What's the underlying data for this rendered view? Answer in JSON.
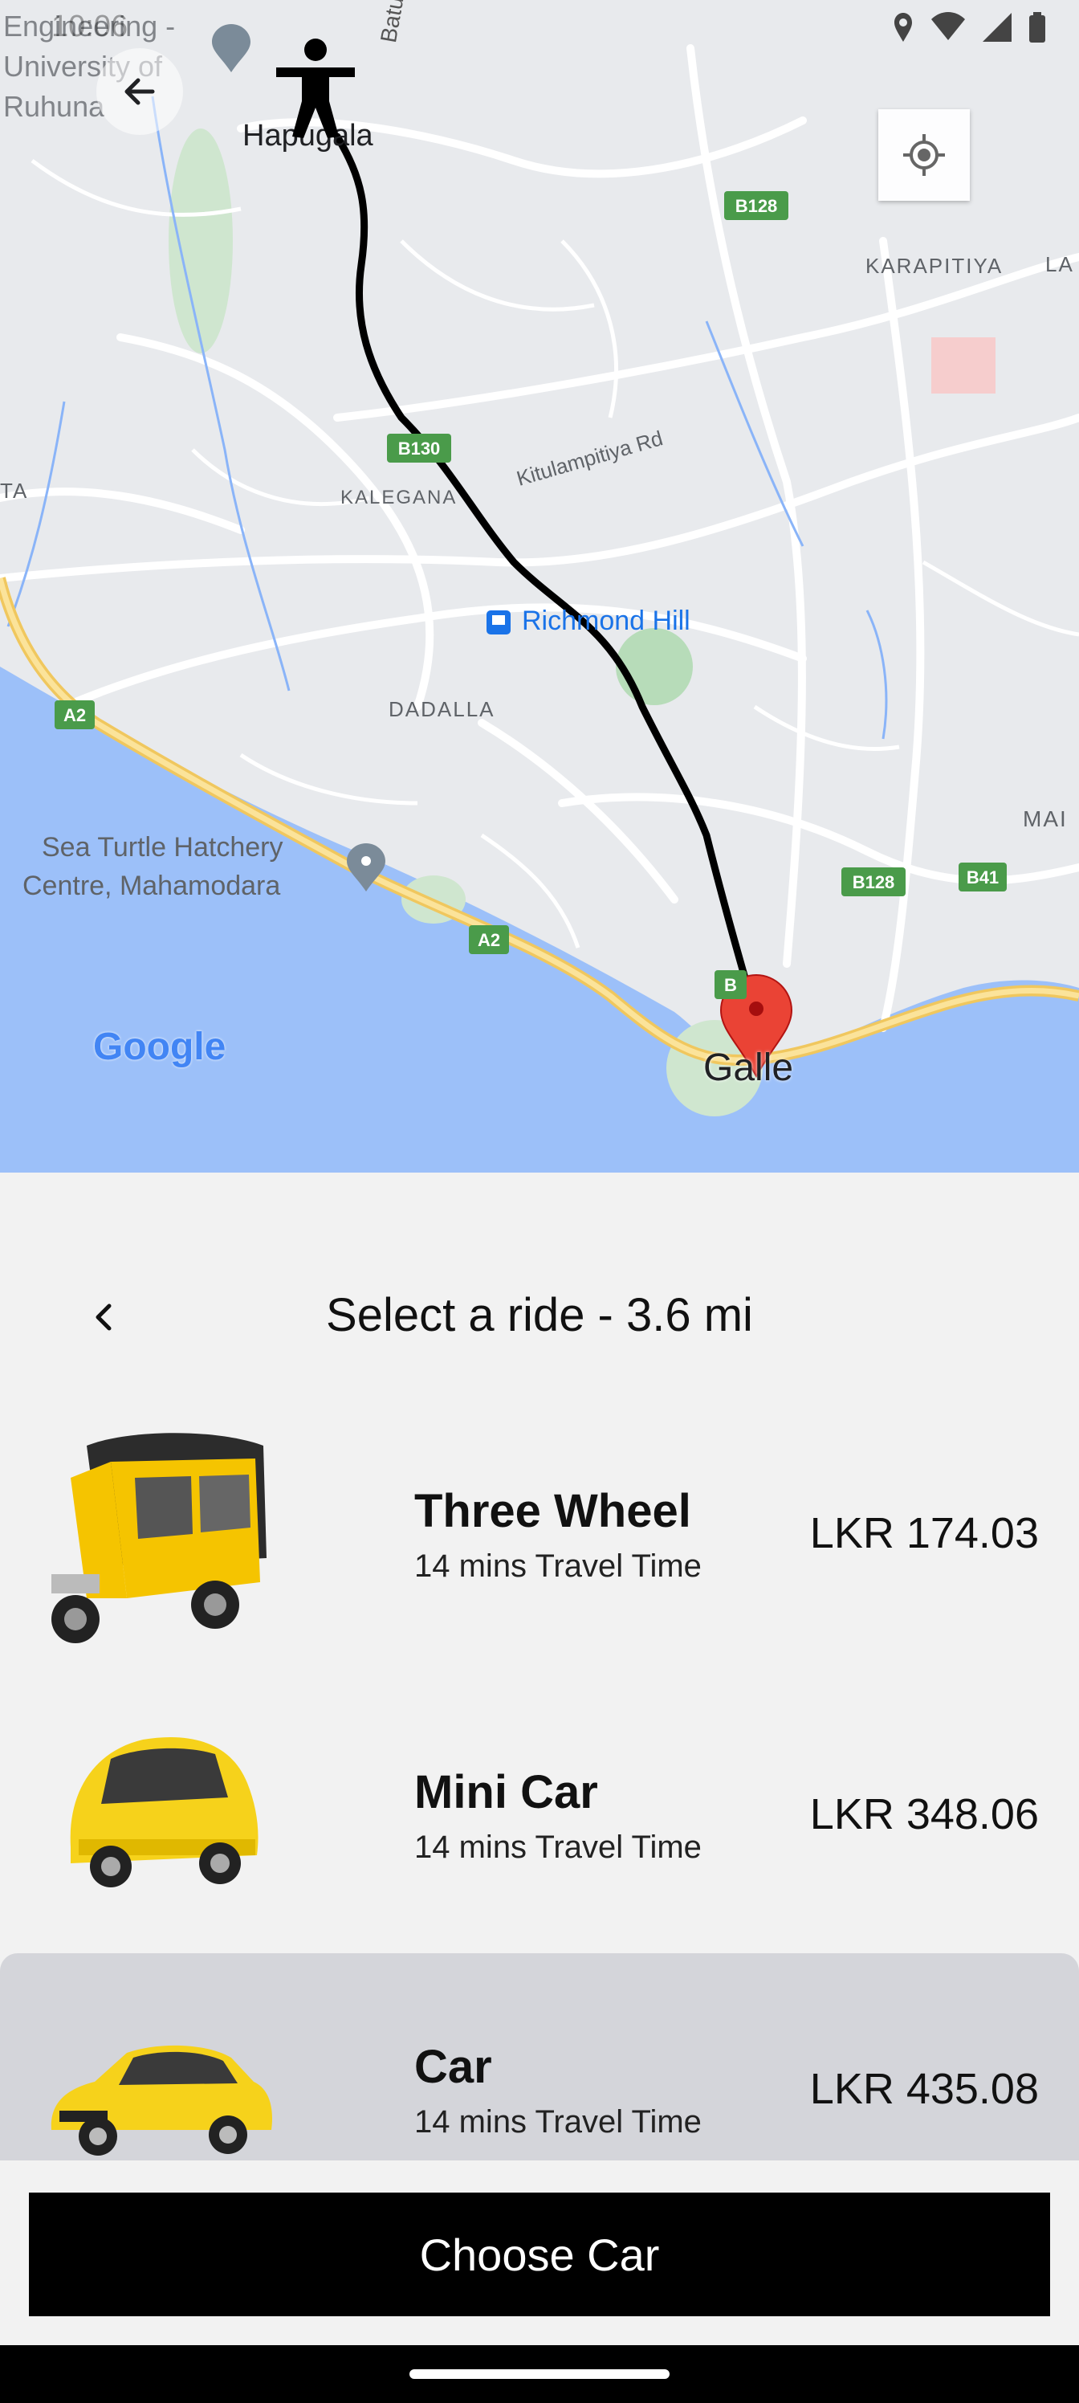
{
  "status": {
    "time": "10:06"
  },
  "map": {
    "labels": {
      "engineering": "Engineering - University of Ruhuna",
      "hapugala": "Hapugala",
      "batuwan": "Batuwan",
      "karapitiya": "KARAPITIYA",
      "la": "LA",
      "ta": "TA",
      "kulampitiya": "Kitulampitiya Rd",
      "kalegana": "KALEGANA",
      "richmond": "Richmond Hill",
      "dadalla": "DADALLA",
      "seaturtle1": "Sea Turtle Hatchery",
      "seaturtle2": "Centre, Mahamodara",
      "ma": "MAI",
      "galle": "Galle",
      "google": "Google"
    },
    "shields": {
      "b128a": "B128",
      "b130": "B130",
      "a2a": "A2",
      "a2b": "A2",
      "b128b": "B128",
      "b41": "B41",
      "b": "B"
    },
    "colors": {
      "land": "#e8eaed",
      "water": "#9cc0f9",
      "park": "#c8e6c9",
      "route": "#000000",
      "highway": "#f8d87a",
      "pin": "#e53935"
    }
  },
  "panel": {
    "title": "Select a ride - 3.6 mi",
    "rides": [
      {
        "name": "Three Wheel",
        "time": "14 mins Travel Time",
        "price": "LKR 174.03",
        "image": "yellow-tuk-tuk"
      },
      {
        "name": "Mini Car",
        "time": "14 mins Travel Time",
        "price": "LKR 348.06",
        "image": "yellow-mini-car"
      },
      {
        "name": "Car",
        "time": "14 mins Travel Time",
        "price": "LKR 435.08",
        "image": "yellow-sedan"
      }
    ],
    "selected_index": 2,
    "cta": "Choose Car"
  }
}
